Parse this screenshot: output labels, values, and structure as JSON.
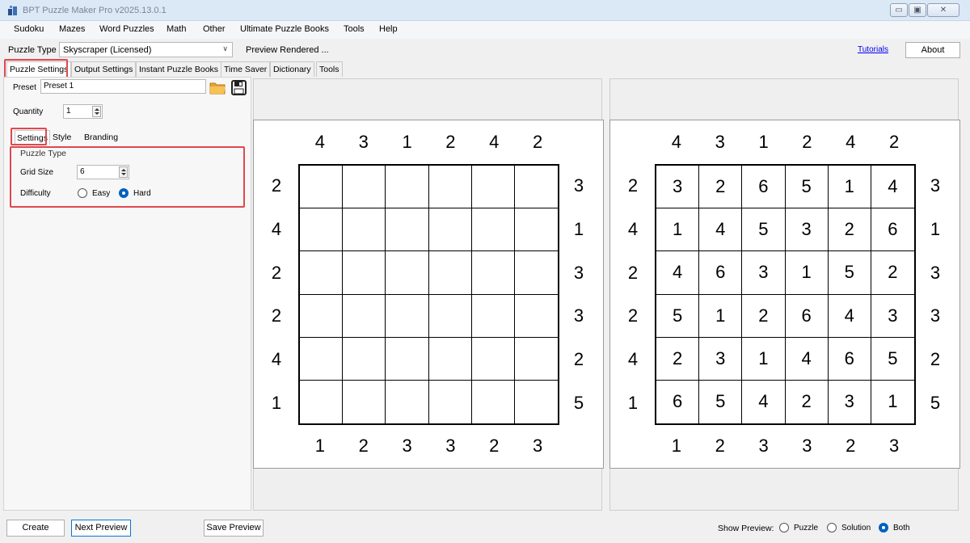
{
  "window": {
    "title": "BPT Puzzle Maker Pro v2025.13.0.1"
  },
  "menu": [
    "Sudoku",
    "Mazes",
    "Word Puzzles",
    "Math",
    "Other",
    "Ultimate Puzzle Books",
    "Tools",
    "Help"
  ],
  "toolbar": {
    "puzzle_type_label": "Puzzle Type",
    "puzzle_type_value": "Skyscraper (Licensed)",
    "preview_status": "Preview Rendered ...",
    "tutorials": "Tutorials",
    "about": "About"
  },
  "tabs": [
    "Puzzle Settings",
    "Output Settings",
    "Instant Puzzle Books",
    "Time Saver",
    "Dictionary",
    "Tools"
  ],
  "settings": {
    "preset_label": "Preset",
    "preset_value": "Preset 1",
    "quantity_label": "Quantity",
    "quantity_value": "1",
    "subtabs": [
      "Settings",
      "Style",
      "Branding"
    ],
    "group_title": "Puzzle Type",
    "grid_size_label": "Grid Size",
    "grid_size_value": "6",
    "difficulty_label": "Difficulty",
    "difficulty_options": [
      "Easy",
      "Hard"
    ],
    "difficulty_selected": "Hard"
  },
  "puzzle": {
    "top": [
      "4",
      "3",
      "1",
      "2",
      "4",
      "2"
    ],
    "bottom": [
      "1",
      "2",
      "3",
      "3",
      "2",
      "3"
    ],
    "left": [
      "2",
      "4",
      "2",
      "2",
      "4",
      "1"
    ],
    "right": [
      "3",
      "1",
      "3",
      "3",
      "2",
      "5"
    ],
    "solution": [
      [
        "3",
        "2",
        "6",
        "5",
        "1",
        "4"
      ],
      [
        "1",
        "4",
        "5",
        "3",
        "2",
        "6"
      ],
      [
        "4",
        "6",
        "3",
        "1",
        "5",
        "2"
      ],
      [
        "5",
        "1",
        "2",
        "6",
        "4",
        "3"
      ],
      [
        "2",
        "3",
        "1",
        "4",
        "6",
        "5"
      ],
      [
        "6",
        "5",
        "4",
        "2",
        "3",
        "1"
      ]
    ]
  },
  "bottom_bar": {
    "create": "Create",
    "next_preview": "Next Preview",
    "save_preview": "Save Preview",
    "show_preview_label": "Show Preview:",
    "show_options": [
      "Puzzle",
      "Solution",
      "Both"
    ],
    "show_selected": "Both"
  },
  "colors": {
    "highlight": "#e0484e",
    "radio_selected": "#0060c0",
    "link": "#0000ee"
  }
}
